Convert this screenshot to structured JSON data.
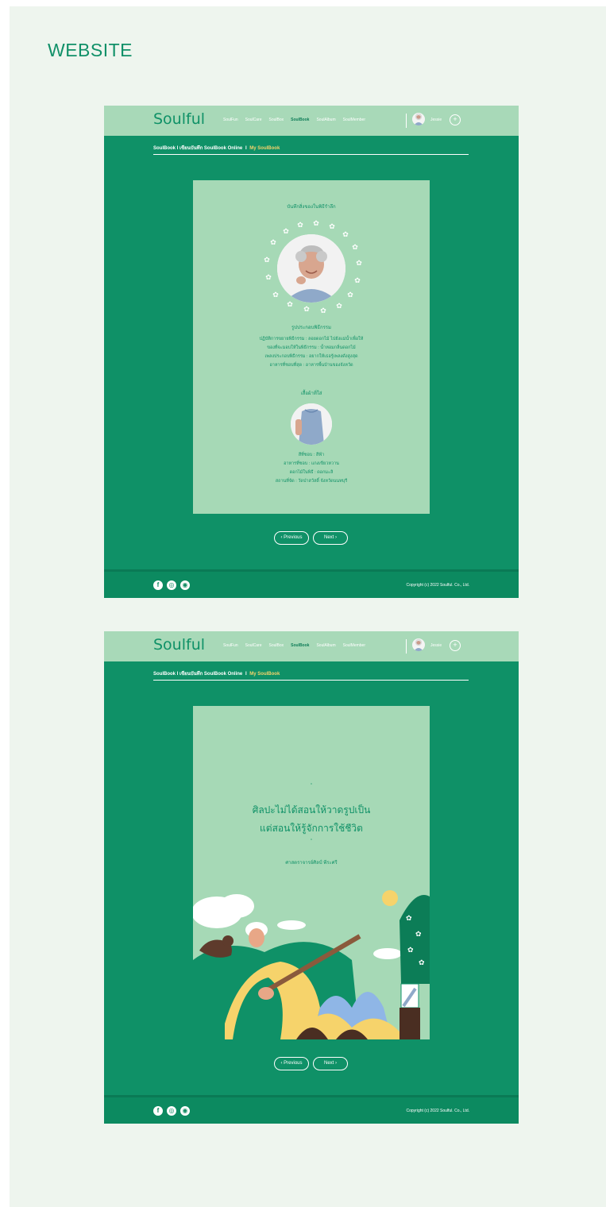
{
  "page_heading": "WEBSITE",
  "brand": {
    "accent": "#0f9167",
    "nav_bg": "#a8d9b8",
    "page_bg": "#a6d9b6",
    "highlight": "#f6d36b"
  },
  "nav": {
    "logo": "Soulful",
    "links": [
      "SoulFun",
      "SoulCare",
      "SoulBox",
      "SoulBook",
      "SoulAlbum",
      "SoulMember"
    ],
    "active_link": "SoulBook",
    "user_name": "Jessie",
    "menu_icon": "plus-icon"
  },
  "breadcrumb": {
    "parent": "SoulBook I เขียนบันทึก SoulBook Online",
    "separator": "I",
    "current": "My SoulBook"
  },
  "screen1": {
    "title": "บันทึกสิ่งของในพิธีรำลึก",
    "section1_title": "รูปประกอบพิธีกรรม",
    "details": [
      "ปฏิบัติการขยายพิธีกรรม : ลอยดอกไม้ ไปยังแม่น้ำเพื่อให้",
      "ของที่จะมอบให้ในพิธีกรรม : น้ำหอมกลิ่นดอกไม้",
      "เพลงประกอบพิธีกรรม : อยากให้เธอรู้เพลงดังสูงสุด",
      "อาหารที่ชอบที่สุด : อาหารพื้นบ้านของจังหวัด"
    ],
    "section2_title": "เสื้อผ้าที่ใส่",
    "attributes": [
      "สีที่ชอบ : สีฟ้า",
      "อาหารที่ชอบ : แกงเขียวหวาน",
      "ดอกไม้ในพิธี : ดอกมะลิ",
      "สถานที่จัด : วัดป่าสวัสดิ์ จังหวัดนนทบุรี"
    ]
  },
  "screen2": {
    "quote_line1": "ศิลปะไม่ได้สอนให้วาดรูปเป็น",
    "quote_line2": "แต่สอนให้รู้จักการใช้ชีวิต",
    "quote_mark": "”",
    "author": "ศาสตราจารย์ศิลป์ พีระศรี"
  },
  "pager": {
    "previous": "‹ Previous",
    "next": "Next ›"
  },
  "footer": {
    "social_icons": [
      "facebook-icon",
      "instagram-icon",
      "line-icon"
    ],
    "copyright": "Copyright (c) 2022 Soulful. Co., Ltd."
  }
}
